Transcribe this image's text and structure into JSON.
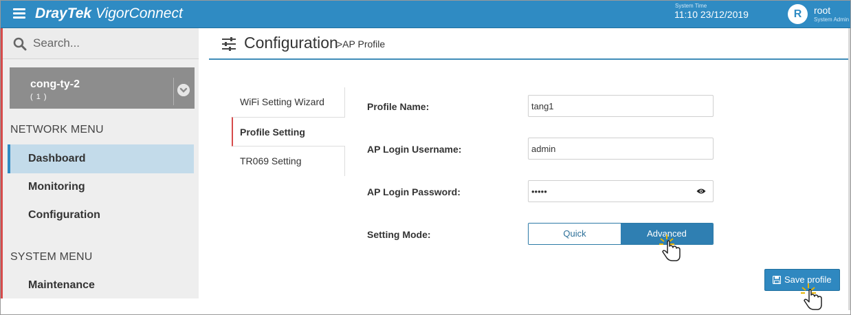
{
  "topbar": {
    "brand_bold": "DrayTek",
    "brand_light": "VigorConnect",
    "system_time_label": "System Time",
    "system_time": "11:10 23/12/2019",
    "avatar_letter": "R",
    "user_name": "root",
    "user_role": "System Admin",
    "icons": [
      "menu-icon"
    ]
  },
  "sidebar": {
    "search_placeholder": "Search...",
    "site": {
      "name": "cong-ty-2",
      "count": "( 1 )"
    },
    "network_menu_heading": "NETWORK MENU",
    "network_items": [
      "Dashboard",
      "Monitoring",
      "Configuration"
    ],
    "active_item": "Dashboard",
    "system_menu_heading": "SYSTEM MENU",
    "system_items": [
      "Maintenance"
    ]
  },
  "header": {
    "title": "Configuration",
    "subtitle": ">AP Profile"
  },
  "tabs": [
    "WiFi Setting Wizard",
    "Profile Setting",
    "TR069 Setting"
  ],
  "active_tab": "Profile Setting",
  "form": {
    "profile_name_label": "Profile Name:",
    "profile_name_value": "tang1",
    "username_label": "AP Login Username:",
    "username_value": "admin",
    "password_label": "AP Login Password:",
    "password_value": "•••••",
    "mode_label": "Setting Mode:",
    "mode_quick": "Quick",
    "mode_advanced": "Advanced",
    "selected_mode": "Advanced"
  },
  "save_button": "Save profile",
  "colors": {
    "topbar": "#2f8bc3",
    "active_menu_bg": "#c3dbea",
    "accent_red": "#d64b4b",
    "site_box": "#8d8d8d",
    "button_blue": "#2f88c0"
  }
}
